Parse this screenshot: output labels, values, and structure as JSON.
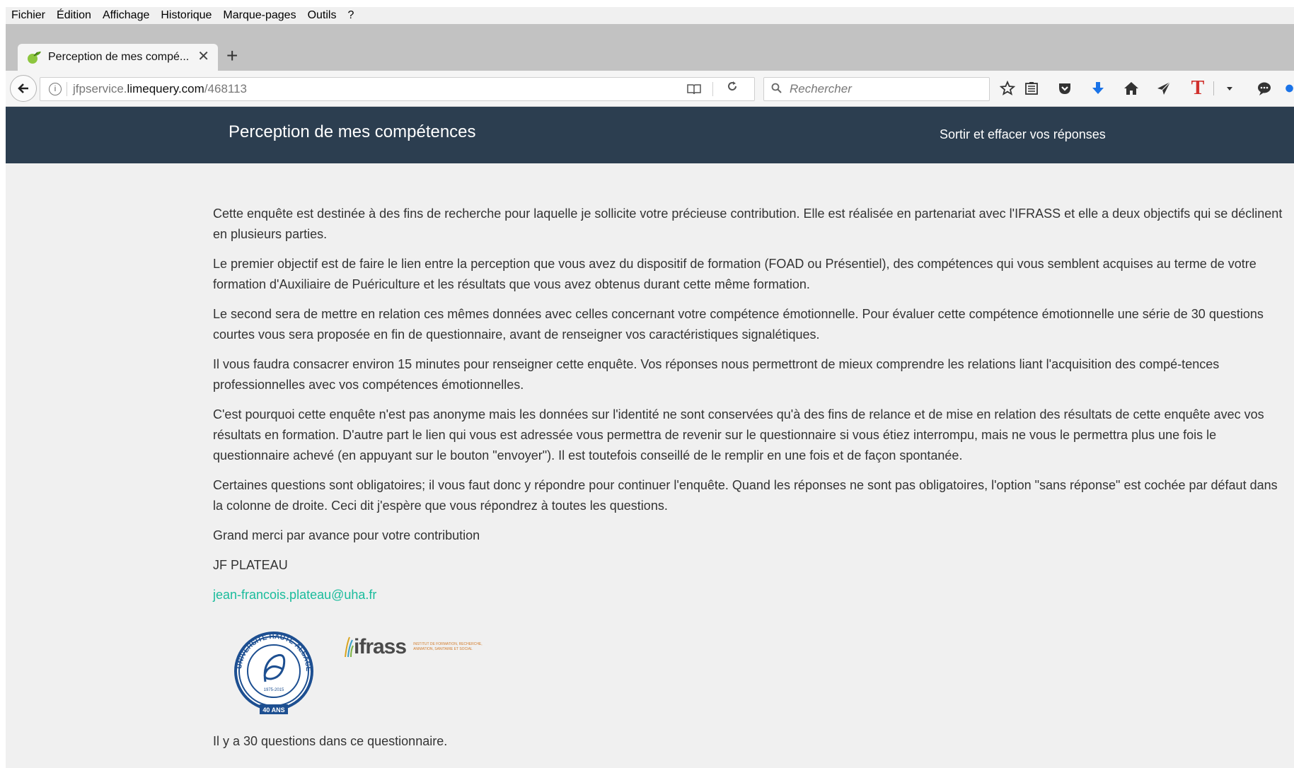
{
  "menubar": {
    "items": [
      "Fichier",
      "Édition",
      "Affichage",
      "Historique",
      "Marque-pages",
      "Outils",
      "?"
    ]
  },
  "tab": {
    "title": "Perception de mes compé...",
    "close_glyph": "✕",
    "new_tab_glyph": "+"
  },
  "navbar": {
    "url_prefix": "jfpservice.",
    "url_host": "limequery.com",
    "url_path": "/468113",
    "search_placeholder": "Rechercher"
  },
  "site_header": {
    "title": "Perception de mes compétences",
    "exit_link": "Sortir et effacer vos réponses"
  },
  "content": {
    "paragraphs": [
      "Cette enquête est destinée à des fins de recherche pour laquelle je sollicite votre précieuse contribution. Elle est réalisée en partenariat avec l'IFRASS et elle a deux  objectifs qui se déclinent en plusieurs parties.",
      "Le premier objectif est de faire le lien entre la perception que vous avez du dispositif de formation (FOAD ou Présentiel), des compétences qui vous semblent acquises au terme de votre formation d'Auxiliaire de Puériculture et les résultats que vous avez obtenus durant cette même formation.",
      "Le second sera de mettre en relation ces mêmes données avec celles concernant votre compétence émotionnelle. Pour évaluer cette compétence émotionnelle une série de 30 questions courtes vous sera proposée en fin de questionnaire, avant de renseigner vos caractéristiques signalétiques.",
      "Il vous faudra consacrer environ 15 minutes pour renseigner cette enquête. Vos réponses nous permettront de mieux comprendre les relations liant l'acquisition des compé-tences professionnelles avec vos compétences émotionnelles.",
      "C'est pourquoi cette enquête n'est pas anonyme mais les données sur l'identité ne sont conservées qu'à des fins de relance et de mise en relation des résultats de cette enquête avec vos résultats en formation. D'autre part le lien qui vous est adressée vous permettra de revenir sur le questionnaire si vous étiez interrompu, mais ne vous le permettra plus  une fois le questionnaire achevé (en appuyant sur le bouton \"envoyer\"). Il est toutefois conseillé de le remplir en une fois et de façon spontanée.",
      "Certaines questions sont obligatoires; il vous faut donc y répondre pour continuer l'enquête. Quand les réponses ne sont pas obligatoires, l'option \"sans réponse\" est cochée par défaut dans la colonne de droite. Ceci dit j'espère que vous répondrez à toutes les questions.",
      "Grand merci par avance pour votre contribution",
      "JF PLATEAU"
    ],
    "email": "jean-francois.plateau@uha.fr",
    "uha_logo": {
      "ring_text": "UNIVERSITÉ HAUTE-ALSACE",
      "years": "1975-2015",
      "anniversary": "40 ANS"
    },
    "ifrass_logo": {
      "word": "ifrass",
      "tagline": "INSTITUT DE FORMATION, RECHERCHE, ANIMATION, SANITAIRE ET SOCIAL"
    },
    "question_count": "Il y a 30 questions dans ce questionnaire."
  },
  "colors": {
    "header_bg": "#2c3e50",
    "link": "#1abc9c",
    "body_text": "#333333",
    "page_bg": "#f0f0f0"
  }
}
